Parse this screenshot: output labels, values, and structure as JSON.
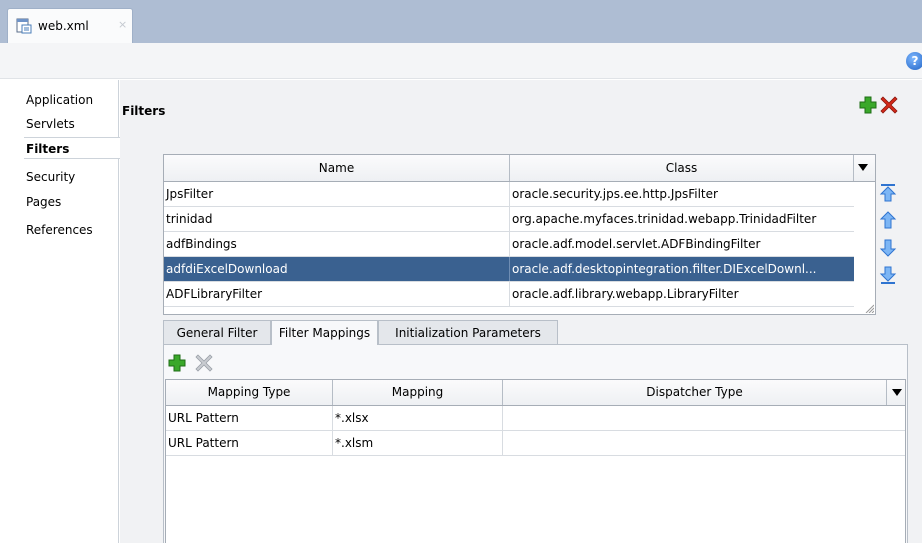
{
  "editor_tab": {
    "label": "web.xml",
    "close": "×"
  },
  "help": {
    "label": "?"
  },
  "nav": {
    "items": [
      {
        "label": "Application"
      },
      {
        "label": "Servlets"
      },
      {
        "label": "Filters",
        "active": true
      },
      {
        "label": "Security"
      },
      {
        "label": "Pages"
      },
      {
        "label": "References"
      }
    ]
  },
  "section": {
    "title": "Filters"
  },
  "filters_table": {
    "columns": [
      "Name",
      "Class"
    ],
    "rows": [
      {
        "name": "JpsFilter",
        "class": "oracle.security.jps.ee.http.JpsFilter"
      },
      {
        "name": "trinidad",
        "class": "org.apache.myfaces.trinidad.webapp.TrinidadFilter"
      },
      {
        "name": "adfBindings",
        "class": "oracle.adf.model.servlet.ADFBindingFilter"
      },
      {
        "name": "adfdiExcelDownload",
        "class": "oracle.adf.desktopintegration.filter.DIExcelDownl...",
        "selected": true
      },
      {
        "name": "ADFLibraryFilter",
        "class": "oracle.adf.library.webapp.LibraryFilter"
      }
    ]
  },
  "sub_tabs": [
    {
      "label": "General Filter"
    },
    {
      "label": "Filter Mappings",
      "active": true
    },
    {
      "label": "Initialization Parameters"
    }
  ],
  "mapping_table": {
    "columns": [
      "Mapping Type",
      "Mapping",
      "Dispatcher Type"
    ],
    "rows": [
      {
        "type": "URL Pattern",
        "mapping": "*.xlsx",
        "dispatcher": ""
      },
      {
        "type": "URL Pattern",
        "mapping": "*.xlsm",
        "dispatcher": ""
      }
    ]
  },
  "colors": {
    "selection": "#3a6190",
    "tab_bar": "#aebdd3",
    "add_green": "#3aa82a",
    "remove_red": "#d42a1a"
  },
  "icons": [
    "xml-file-icon",
    "close-icon",
    "help-icon",
    "add-icon",
    "remove-icon",
    "move-top-icon",
    "move-up-icon",
    "move-down-icon",
    "move-bottom-icon",
    "column-menu-icon"
  ]
}
